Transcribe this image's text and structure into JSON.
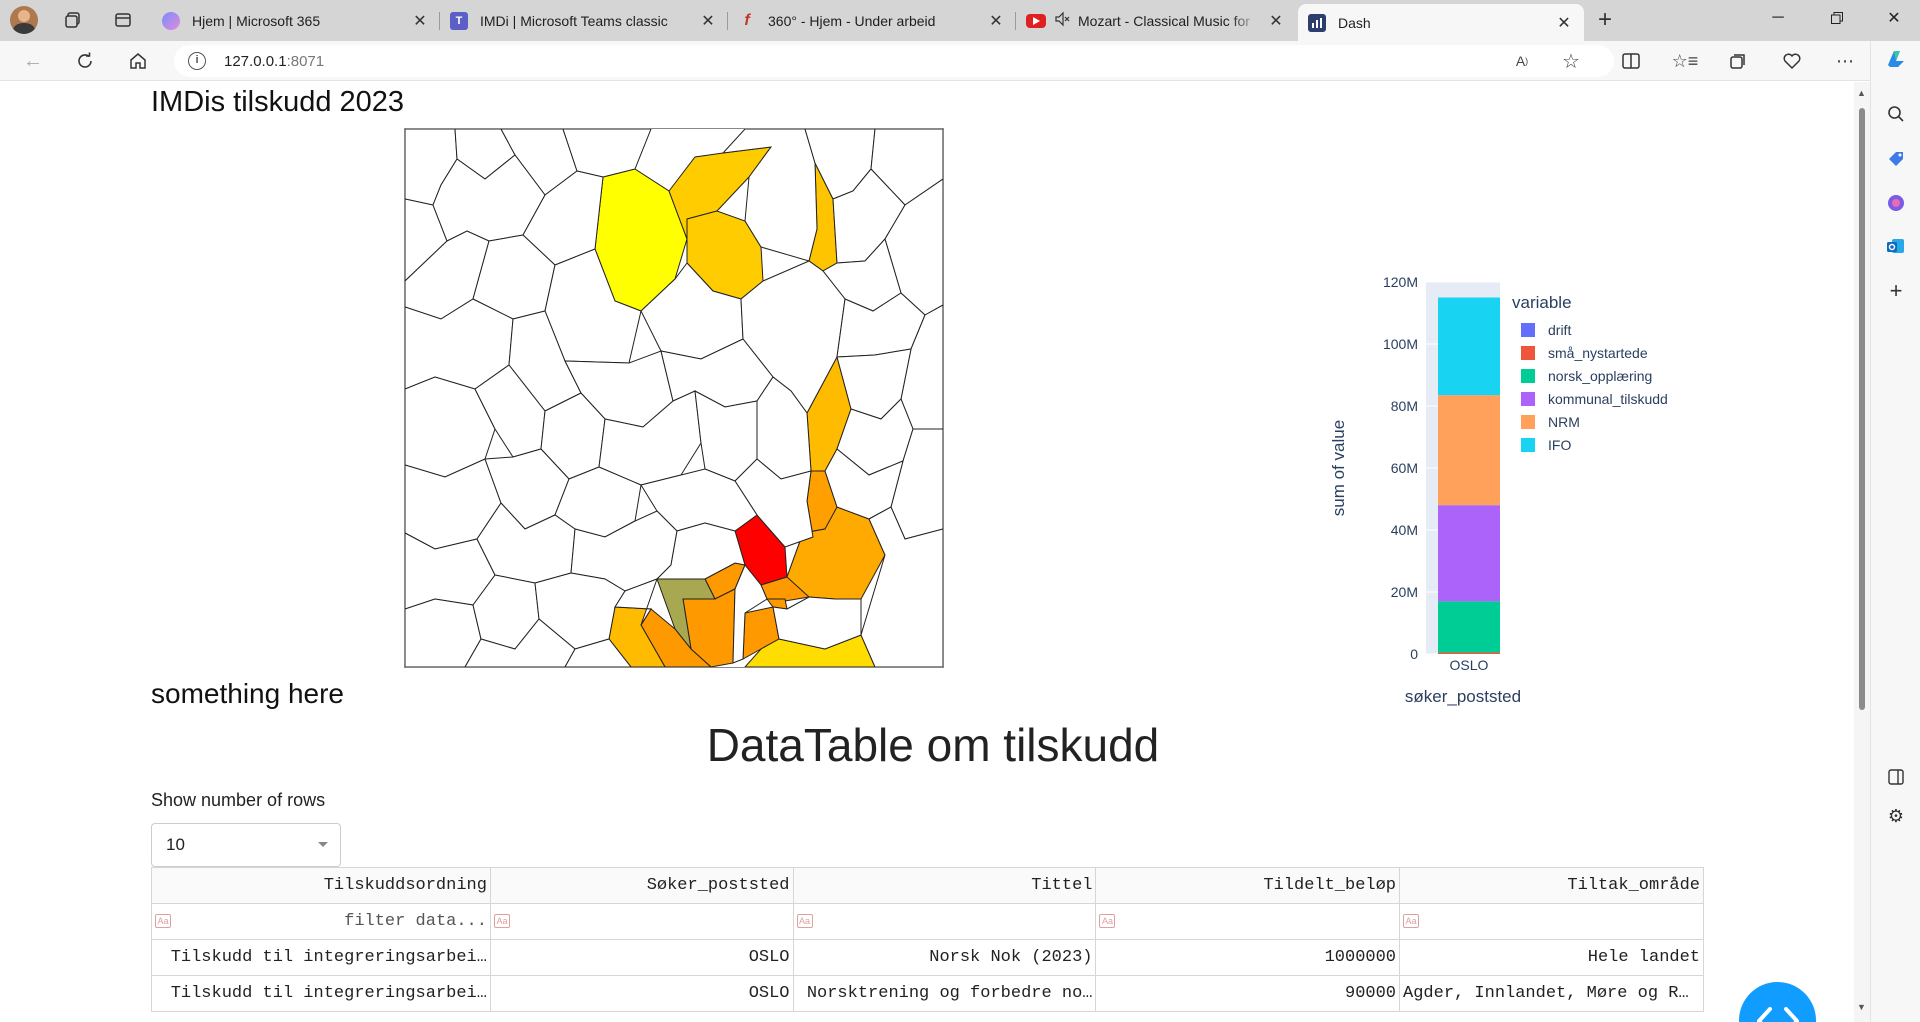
{
  "browser": {
    "tabs": [
      {
        "title": "Hjem | Microsoft 365",
        "icon": "microsoft-365-icon"
      },
      {
        "title": "IMDi | Microsoft Teams classic",
        "icon": "teams-icon"
      },
      {
        "title": "360° - Hjem - Under arbeid",
        "icon": "360-icon"
      },
      {
        "title": "Mozart - Classical Music for",
        "icon": "youtube-icon",
        "muted": true
      },
      {
        "title": "Dash",
        "icon": "dash-icon",
        "active": true
      }
    ],
    "url_host": "127.0.0.1",
    "url_port": ":8071"
  },
  "page": {
    "title": "IMDis tilskudd 2023",
    "subtitle": "something here",
    "datatable_title": "DataTable om tilskudd",
    "rows_label": "Show number of rows",
    "rows_value": "10"
  },
  "map": {
    "description_colors": [
      "#ffff00",
      "#ffcc00",
      "#ffaa00",
      "#ff9900",
      "#ff0000",
      "#a8a850",
      "#ffffff"
    ]
  },
  "chart_data": {
    "type": "bar",
    "stacked": true,
    "categories": [
      "OSLO"
    ],
    "series": [
      {
        "name": "drift",
        "values": [
          0
        ],
        "color": "#636efa"
      },
      {
        "name": "små_nystartede",
        "values": [
          0.5
        ],
        "color": "#ef553b"
      },
      {
        "name": "norsk_opplæring",
        "values": [
          16.5
        ],
        "color": "#00cc96"
      },
      {
        "name": "kommunal_tilskudd",
        "values": [
          31
        ],
        "color": "#ab63fa"
      },
      {
        "name": "NRM",
        "values": [
          35.5
        ],
        "color": "#ffa15a"
      },
      {
        "name": "IFO",
        "values": [
          31.5
        ],
        "color": "#19d3f3"
      }
    ],
    "xlabel": "søker_poststed",
    "ylabel": "sum of value",
    "legend_title": "variable",
    "ylim": [
      0,
      120
    ],
    "yticks": [
      "0",
      "20M",
      "40M",
      "60M",
      "80M",
      "100M",
      "120M"
    ],
    "legend_position": "right"
  },
  "table": {
    "columns": [
      "Tilskuddsordning",
      "Søker_poststed",
      "Tittel",
      "Tildelt_beløp",
      "Tiltak_område"
    ],
    "filter_placeholder": "filter data...",
    "case_toggle": "Aa",
    "rows": [
      [
        "Tilskudd til integreringsarbei…",
        "OSLO",
        "Norsk Nok (2023)",
        "1000000",
        "Hele landet"
      ],
      [
        "Tilskudd til integreringsarbei…",
        "OSLO",
        "Norsktrening og forbedre no…",
        "90000",
        "Agder, Innlandet, Møre og R…"
      ]
    ]
  }
}
